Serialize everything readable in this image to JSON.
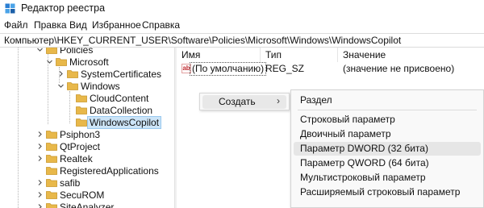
{
  "window": {
    "title": "Редактор реестра",
    "icon": "regedit-icon"
  },
  "menu": [
    "Файл",
    "Правка",
    "Вид",
    "Избранное",
    "Справка"
  ],
  "address": "Компьютер\\HKEY_CURRENT_USER\\Software\\Policies\\Microsoft\\Windows\\WindowsCopilot",
  "tree": {
    "nodes": [
      {
        "label": "Policies",
        "expanded": true
      },
      {
        "label": "Microsoft",
        "expanded": true
      },
      {
        "label": "SystemCertificates",
        "expanded": false
      },
      {
        "label": "Windows",
        "expanded": true
      },
      {
        "label": "CloudContent",
        "expanded": null
      },
      {
        "label": "DataCollection",
        "expanded": null
      },
      {
        "label": "WindowsCopilot",
        "expanded": null,
        "selected": true
      },
      {
        "label": "Psiphon3",
        "expanded": false
      },
      {
        "label": "QtProject",
        "expanded": false
      },
      {
        "label": "Realtek",
        "expanded": false
      },
      {
        "label": "RegisteredApplications",
        "expanded": null
      },
      {
        "label": "safib",
        "expanded": false
      },
      {
        "label": "SecuROM",
        "expanded": false
      },
      {
        "label": "SiteAnalyzer",
        "expanded": false
      }
    ]
  },
  "values": {
    "columns": [
      "Имя",
      "Тип",
      "Значение"
    ],
    "rows": [
      {
        "name": "(По умолчанию)",
        "type": "REG_SZ",
        "data": "(значение не присвоено)",
        "icon": "ab-string-icon"
      }
    ]
  },
  "context_menu": {
    "item": "Создать",
    "arrow": "›"
  },
  "submenu": {
    "items": [
      "Раздел",
      "Строковый параметр",
      "Двоичный параметр",
      "Параметр DWORD (32 бита)",
      "Параметр QWORD (64 бита)",
      "Мультистроковый параметр",
      "Расширяемый строковый параметр"
    ],
    "highlighted": "Параметр DWORD (32 бита)"
  },
  "colors": {
    "folder": "#e8b84a",
    "selection": "#cce4f7",
    "menu_hover": "#e6e6e6"
  }
}
